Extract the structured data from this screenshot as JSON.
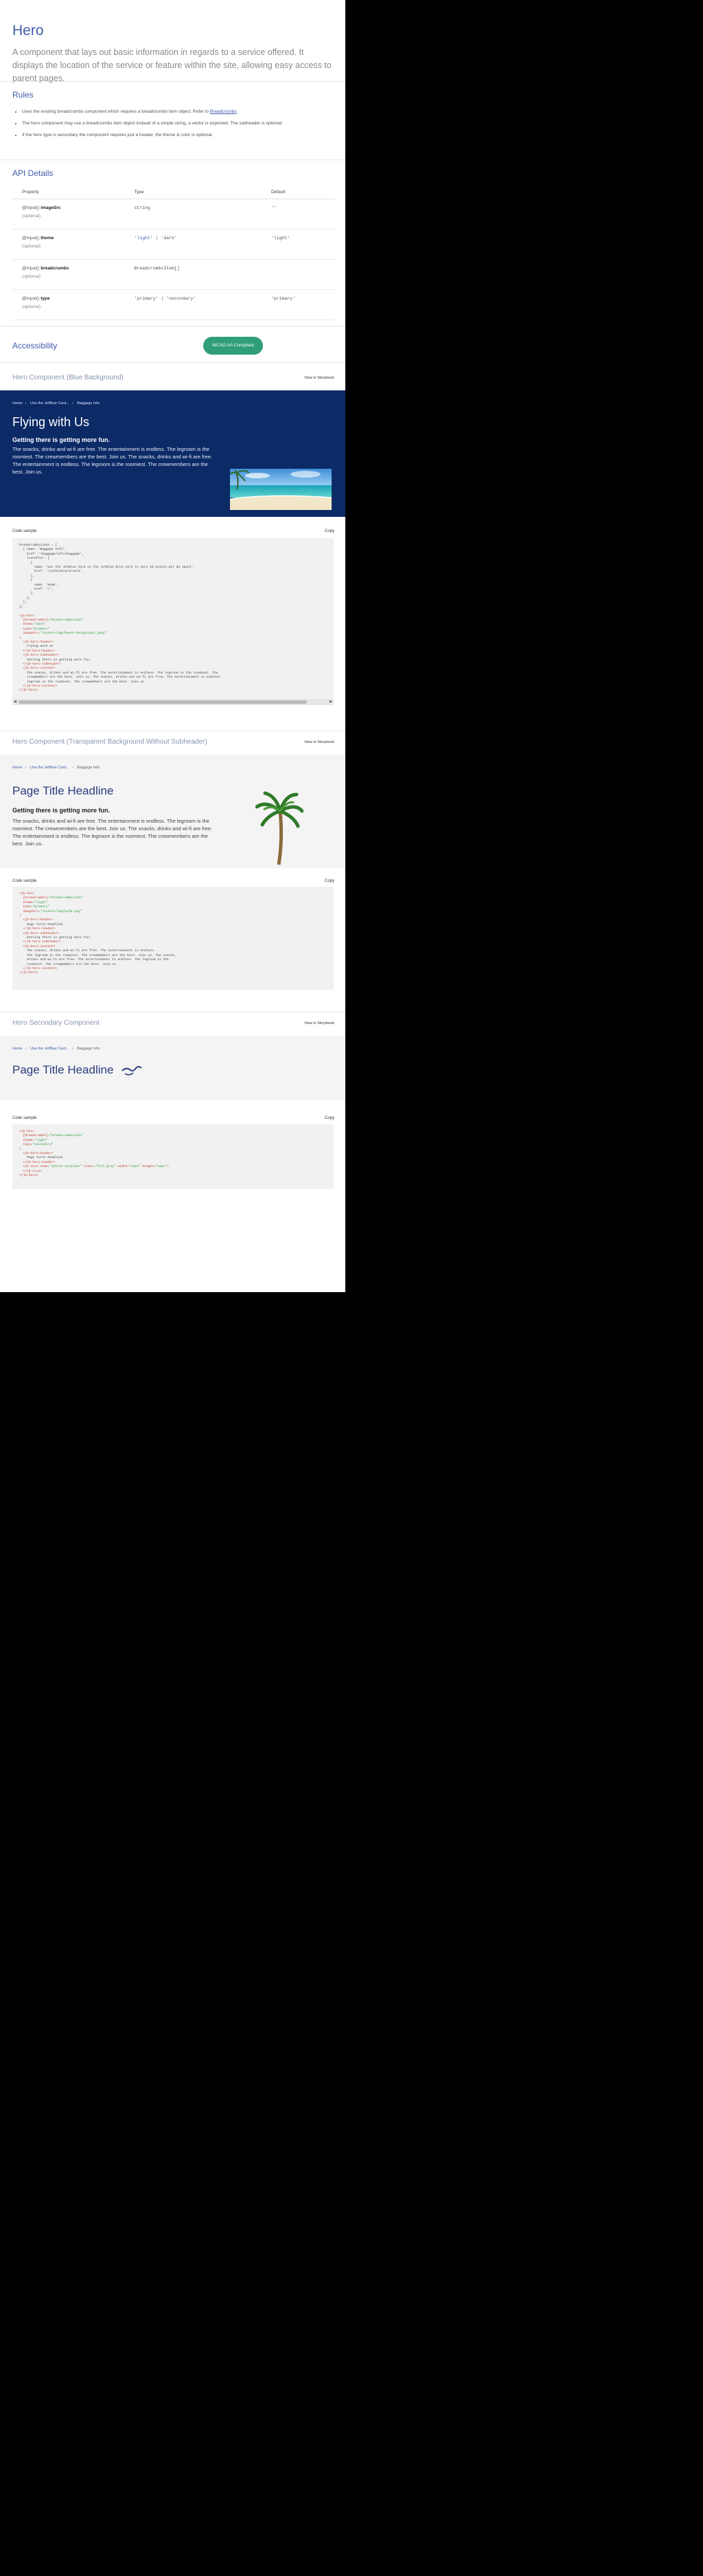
{
  "page": {
    "title": "Hero",
    "intro": "A component that lays out basic information in regards to a service offered. It displays the location of the service or feature within the site, allowing easy access to parent pages."
  },
  "rules": {
    "title": "Rules",
    "items": [
      {
        "text": "Uses the existing breadcrumbs component which requires a breadcrumbs item object. Refer to ",
        "link": "Breadcrumbs",
        "tail": "."
      },
      {
        "text": "The hero component may use a breadcrumbs item object instead of a simple string, a vector is expected. The subheader is optional.",
        "link": "",
        "tail": ""
      },
      {
        "text": "If the hero type is secondary the component requires just a header, the theme & color is optional.",
        "link": "",
        "tail": ""
      }
    ]
  },
  "api": {
    "title": "API Details",
    "headers": [
      "Property",
      "Type",
      "Default"
    ],
    "optional_label": "(optional)",
    "rows": [
      {
        "prefix": "@Input() ",
        "name": "imageSrc",
        "type": "string",
        "default": "''"
      },
      {
        "prefix": "@Input() ",
        "name": "theme",
        "type_a": "'light'",
        "type_sep": " | ",
        "type_b": "'dark'",
        "default": "'light'"
      },
      {
        "prefix": "@Input() ",
        "name": "breadcrumbs",
        "type": "BreadcrumbsItem[]",
        "default": ""
      },
      {
        "prefix": "@Input() ",
        "name": "type",
        "type": "'primary' | 'secondary'",
        "default": "'primary'"
      }
    ]
  },
  "accessibility": {
    "title": "Accessibility",
    "badge": "WCAG AA Compliant"
  },
  "view_link": "View in Storybook",
  "code_label": "Code sample",
  "copy_label": "Copy",
  "demo1": {
    "title": "Hero Component (Blue Background)",
    "breadcrumbs": [
      "Home",
      "Use the JetBlue Card...",
      "Baggage Info"
    ],
    "heading": "Flying with Us",
    "subheading": "Getting there is getting more fun.",
    "body": "The snacks, drinks and wi-fi are free. The entertainment is endless. The legroom is the roomiest. The crewmembers are the best. Join us. The snacks, drinks and wi-fi are free. The entertainment is endless. The legroom is the roomiest. The crewmembers are the best. Join us."
  },
  "demo2": {
    "title": "Hero Component (Transparent Background Without Subheader)",
    "breadcrumbs": [
      "Home",
      "Use the JetBlue Card...",
      "Baggage Info"
    ],
    "heading": "Page Title Headline",
    "subheading": "Getting there is getting more fun.",
    "body": "The snacks, drinks and wi-fi are free. The entertainment is endless. The legroom is the roomiest. The crewmembers are the best. Join us. The snacks, drinks and wi-fi are free. The entertainment is endless. The legroom is the roomiest. The crewmembers are the best. Join us."
  },
  "demo3": {
    "title": "Hero Secondary Component",
    "breadcrumbs": [
      "Home",
      "Use the JetBlue Card...",
      "Baggage Info"
    ],
    "heading": "Page Title Headline"
  },
  "colors": {
    "brand_blue": "#0c2a66",
    "accent": "#3f5caa",
    "badge_green": "#2f9e79"
  }
}
